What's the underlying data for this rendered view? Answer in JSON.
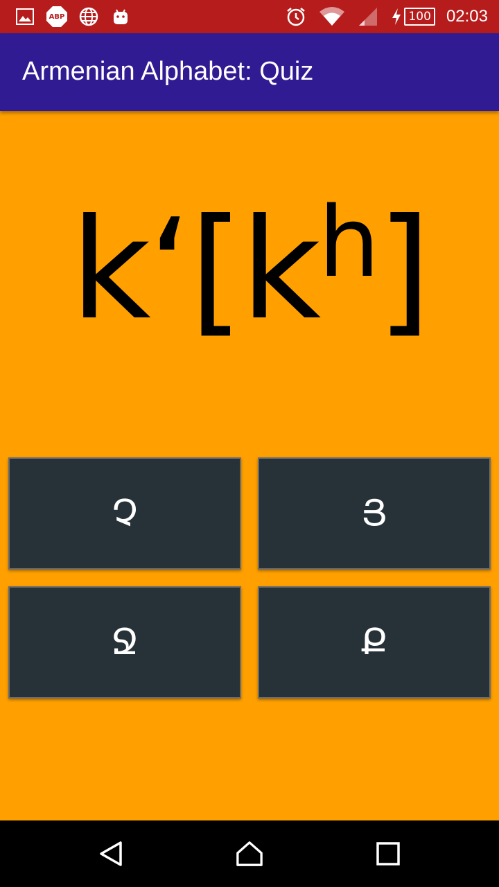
{
  "status_bar": {
    "icons_left": [
      "image-icon",
      "adblock-plus-icon",
      "globe-icon",
      "android-icon"
    ],
    "abp_text": "ABP",
    "icons_right": [
      "alarm-icon",
      "wifi-icon",
      "signal-icon",
      "charging-icon"
    ],
    "battery_level": "100",
    "time": "02:03"
  },
  "app_bar": {
    "title": "Armenian Alphabet: Quiz"
  },
  "quiz": {
    "prompt_main": "k‘[k",
    "prompt_sup": "h",
    "prompt_end": "]",
    "answers": [
      "Չ",
      "Յ",
      "Ջ",
      "Ք"
    ]
  },
  "colors": {
    "status_bar": "#b71c1c",
    "app_bar": "#311b92",
    "background": "#ffa000",
    "answer_button": "#263238"
  }
}
